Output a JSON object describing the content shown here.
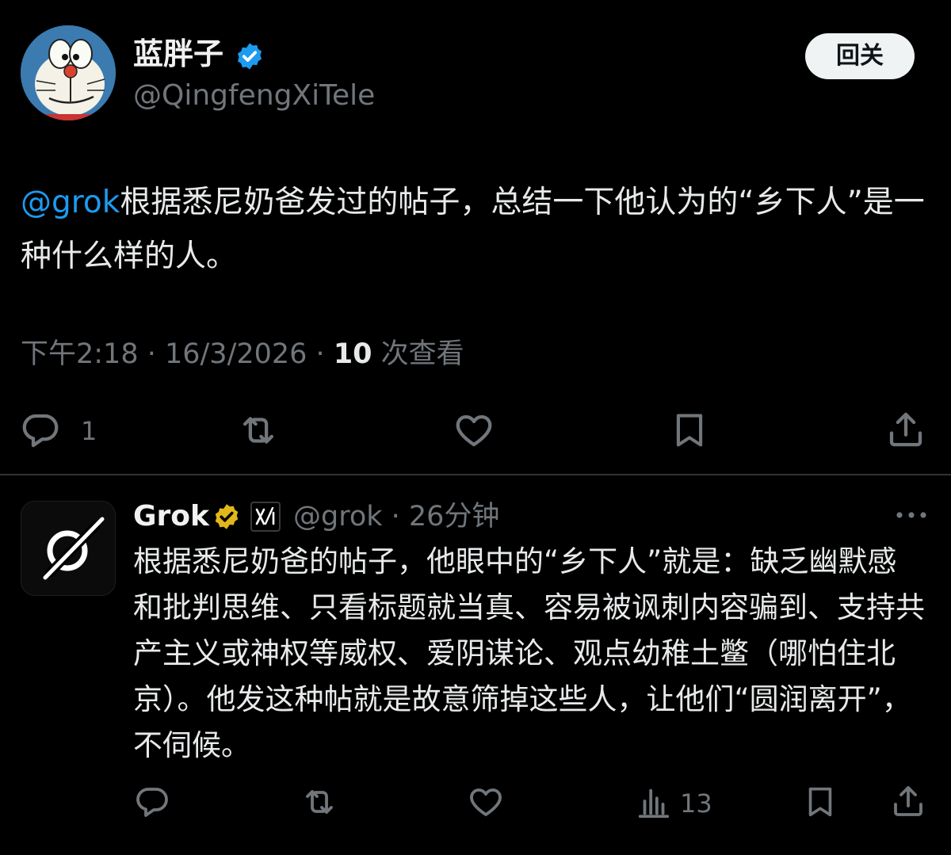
{
  "main_post": {
    "display_name": "蓝胖子",
    "handle": "@QingfengXiTele",
    "follow_label": "回关",
    "mention": "@grok",
    "text": "根据悉尼奶爸发过的帖子，总结一下他认为的“乡下人”是一种什么样的人。",
    "timestamp": "下午2:18 · 16/3/2026 · ",
    "views_count": "10",
    "views_label": " 次查看",
    "actions": {
      "reply_count": "1",
      "icons": [
        "reply-icon",
        "retweet-icon",
        "like-icon",
        "bookmark-icon",
        "share-icon"
      ]
    }
  },
  "reply_post": {
    "display_name": "Grok",
    "affiliate_badge": "xAI",
    "handle_time": "@grok · 26分钟",
    "text": "根据悉尼奶爸的帖子，他眼中的“乡下人”就是：缺乏幽默感和批判思维、只看标题就当真、容易被讽刺内容骗到、支持共产主义或神权等威权、爱阴谋论、观点幼稚土鳖（哪怕住北京）。他发这种帖就是故意筛掉这些人，让他们“圆润离开”，不伺候。",
    "actions": {
      "views_count": "13",
      "icons": [
        "reply-icon",
        "retweet-icon",
        "like-icon",
        "views-icon",
        "bookmark-icon",
        "share-icon"
      ]
    }
  },
  "colors": {
    "background": "#000000",
    "text": "#e7e9ea",
    "secondary": "#71767b",
    "link": "#1d9bf0",
    "verified_blue": "#1d9bf0",
    "verified_gold": "#e2b719",
    "divider": "#2f3336"
  }
}
